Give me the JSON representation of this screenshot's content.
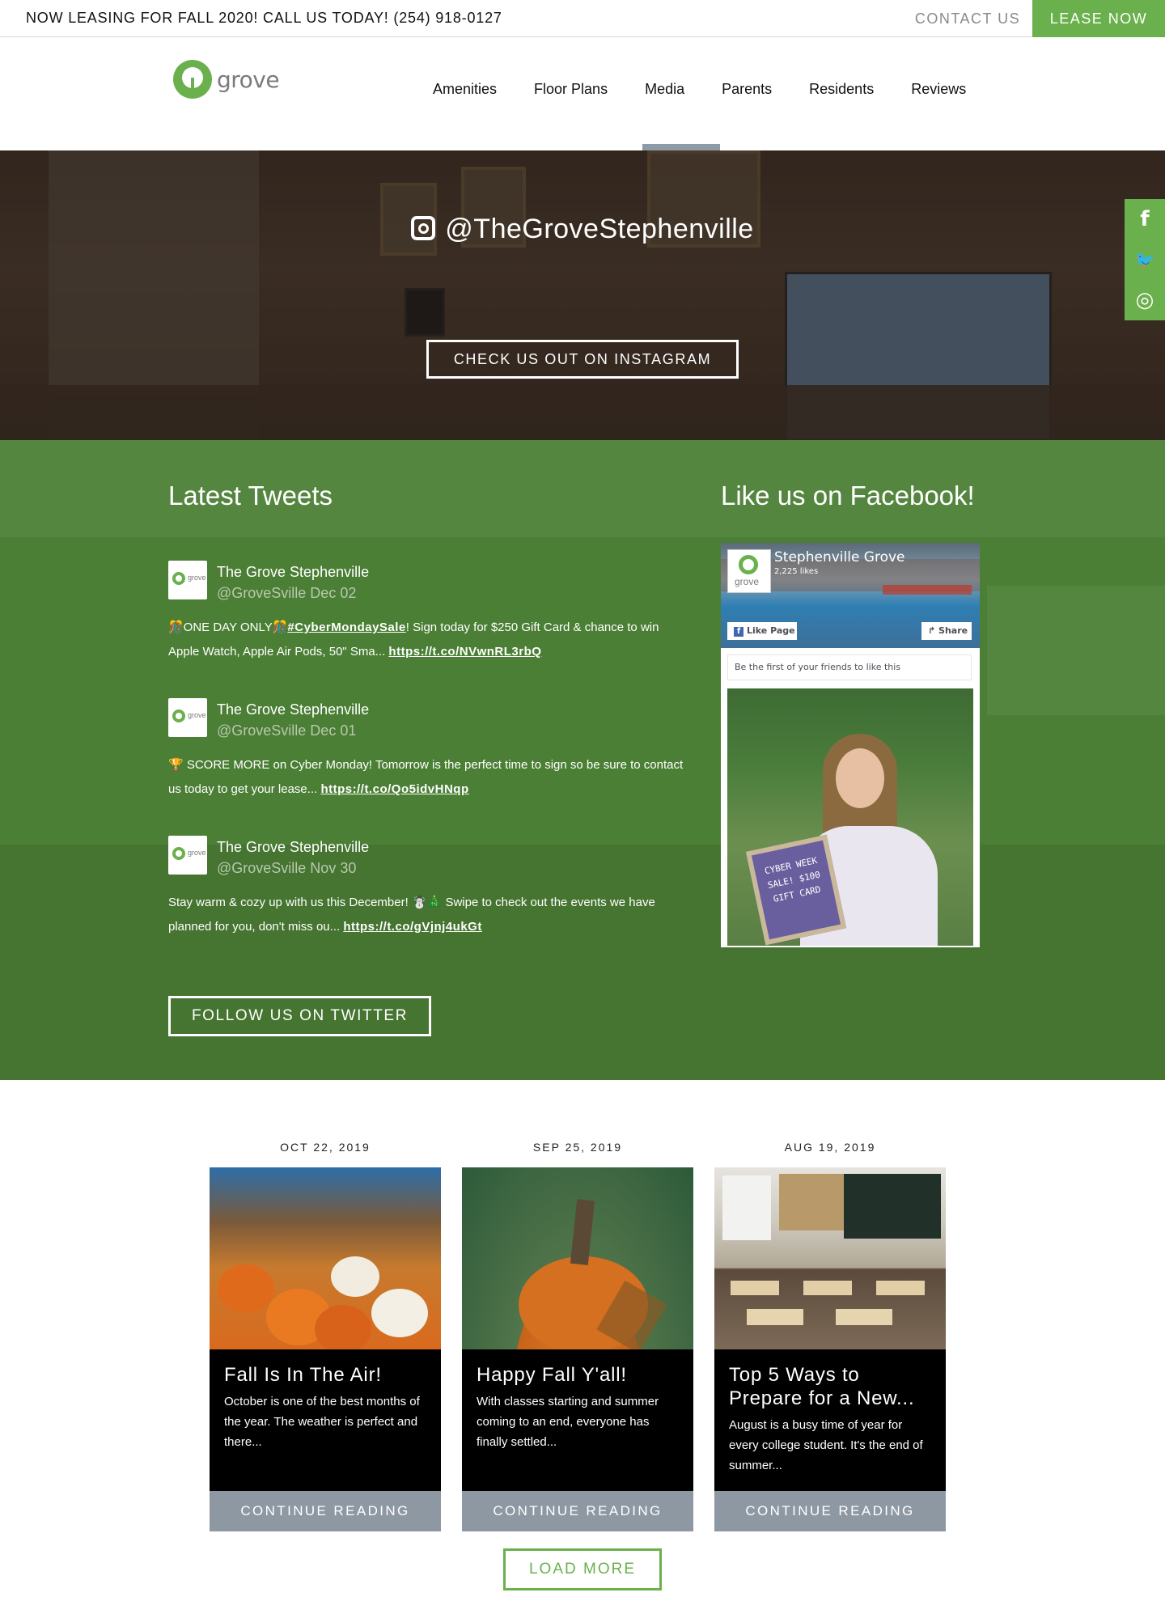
{
  "topbar": {
    "promo": "NOW LEASING FOR FALL 2020! CALL US TODAY! (254) 918-0127",
    "contact": "CONTACT US",
    "lease": "LEASE NOW"
  },
  "brand": {
    "logo_text": "grove",
    "accent": "#6ab04c"
  },
  "nav": [
    "Amenities",
    "Floor Plans",
    "Media",
    "Parents",
    "Residents",
    "Reviews"
  ],
  "nav_active": "Media",
  "instagram": {
    "handle": "@TheGroveStephenville",
    "button": "CHECK US OUT ON INSTAGRAM",
    "icon": "instagram-icon"
  },
  "social_icons": [
    "facebook-icon",
    "twitter-icon",
    "instagram-icon"
  ],
  "social_glyphs": [
    "f",
    "🐦",
    "◎"
  ],
  "tweets_heading": "Latest Tweets",
  "tweets": [
    {
      "name": "The Grove Stephenville",
      "handle": "@GroveSville Dec 02",
      "text": "🎊ONE DAY ONLY🎊",
      "tag": "#CyberMondaySale",
      "text2": "! Sign today for $250 Gift Card & chance to win Apple Watch, Apple Air Pods, 50\" Sma...",
      "link": "https://t.co/NVwnRL3rbQ"
    },
    {
      "name": "The Grove Stephenville",
      "handle": "@GroveSville Dec 01",
      "text": "🏆 SCORE MORE on Cyber Monday! Tomorrow is the perfect time to sign so be sure to contact us today to get your lease...",
      "link": "https://t.co/Qo5idvHNqp"
    },
    {
      "name": "The Grove Stephenville",
      "handle": "@GroveSville Nov 30",
      "text": "Stay warm & cozy up with us this December! ☃️🎄 Swipe to check out the events we have planned for you, don't miss ou...",
      "link": "https://t.co/gVjnj4ukGt"
    }
  ],
  "follow_twitter": "FOLLOW US ON TWITTER",
  "facebook": {
    "heading": "Like us on Facebook!",
    "page_name": "Stephenville Grove",
    "likes": "2,225 likes",
    "like_page": "Like Page",
    "share": "Share",
    "friends": "Be the first of your friends to like this",
    "sign_text": "CYBER WEEK SALE! $100 GIFT CARD"
  },
  "posts": [
    {
      "date": "OCT 22, 2019",
      "title": "Fall Is In The Air!",
      "excerpt": "October is one of the best months of the year. The weather is perfect and there...",
      "more": "CONTINUE READING"
    },
    {
      "date": "SEP 25, 2019",
      "title": "Happy Fall Y'all!",
      "excerpt": "With classes starting and summer coming to an end, everyone has finally settled...",
      "more": "CONTINUE READING"
    },
    {
      "date": "AUG 19, 2019",
      "title": "Top 5 Ways to Prepare for a New...",
      "excerpt": "August is a busy time of year for every college student. It's the end of summer...",
      "more": "CONTINUE READING"
    }
  ],
  "load_more": "LOAD MORE"
}
